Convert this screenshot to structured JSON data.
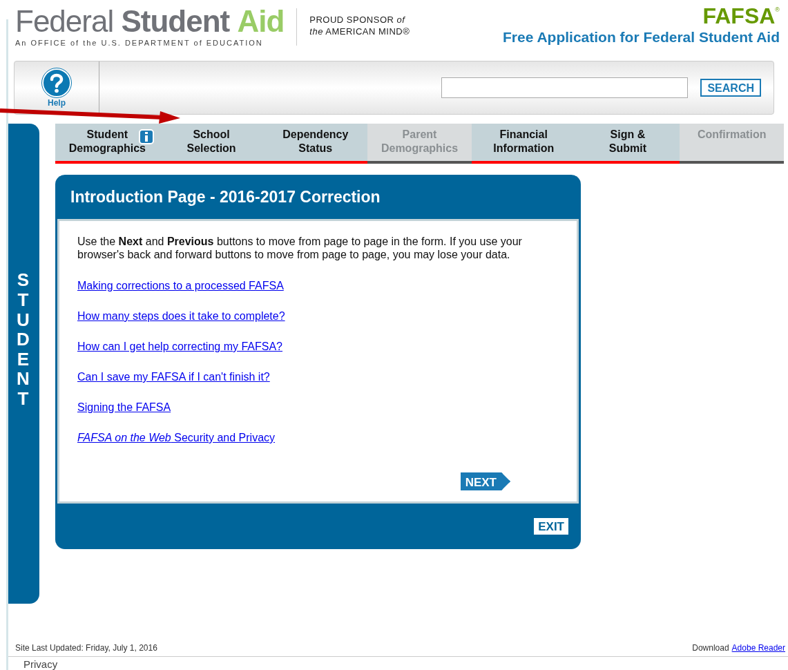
{
  "header": {
    "logo_light": "Federal",
    "logo_bold": "Student",
    "logo_green": "Aid",
    "logo_tagline": "An OFFICE of the U.S. DEPARTMENT of EDUCATION",
    "sponsor_line1": "PROUD SPONSOR *of*",
    "sponsor_line2": "*the* AMERICAN MIND®",
    "fafsa": "FAFSA",
    "fafsa_mark": "®",
    "fafsa_title": "Free Application for Federal Student Aid"
  },
  "toolbar": {
    "help_label": "Help",
    "search_button": "SEARCH"
  },
  "tabs": [
    {
      "line1": "Student",
      "line2": "Demographics",
      "disabled": false,
      "info": true
    },
    {
      "line1": "School",
      "line2": "Selection",
      "disabled": false,
      "info": false
    },
    {
      "line1": "Dependency",
      "line2": "Status",
      "disabled": false,
      "info": false
    },
    {
      "line1": "Parent",
      "line2": "Demographics",
      "disabled": true,
      "info": false
    },
    {
      "line1": "Financial",
      "line2": "Information",
      "disabled": false,
      "info": false
    },
    {
      "line1": "Sign &",
      "line2": "Submit",
      "disabled": false,
      "info": false
    },
    {
      "line1": "Confirmation",
      "disabled": true,
      "info": false
    }
  ],
  "side_label": "STUDENT",
  "panel": {
    "title": "Introduction Page - 2016-2017 Correction",
    "intro": "Use the **Next** and **Previous** buttons to move from page to page in the form. If you use your browser's back and forward buttons to move from page to page, you may lose your data.",
    "links": [
      "Making corrections to a processed FAFSA",
      "How many steps does it take to complete?",
      "How can I get help correcting my FAFSA?",
      "Can I save my FAFSA if I can't finish it?",
      "Signing the FAFSA",
      "*FAFSA on the Web* Security and Privacy"
    ],
    "next_button": "NEXT",
    "exit_button": "EXIT"
  },
  "footer": {
    "updated": "Site Last Updated: Friday, July 1, 2016",
    "download": "Download",
    "download_link": "Adobe Reader",
    "privacy": "Privacy"
  }
}
